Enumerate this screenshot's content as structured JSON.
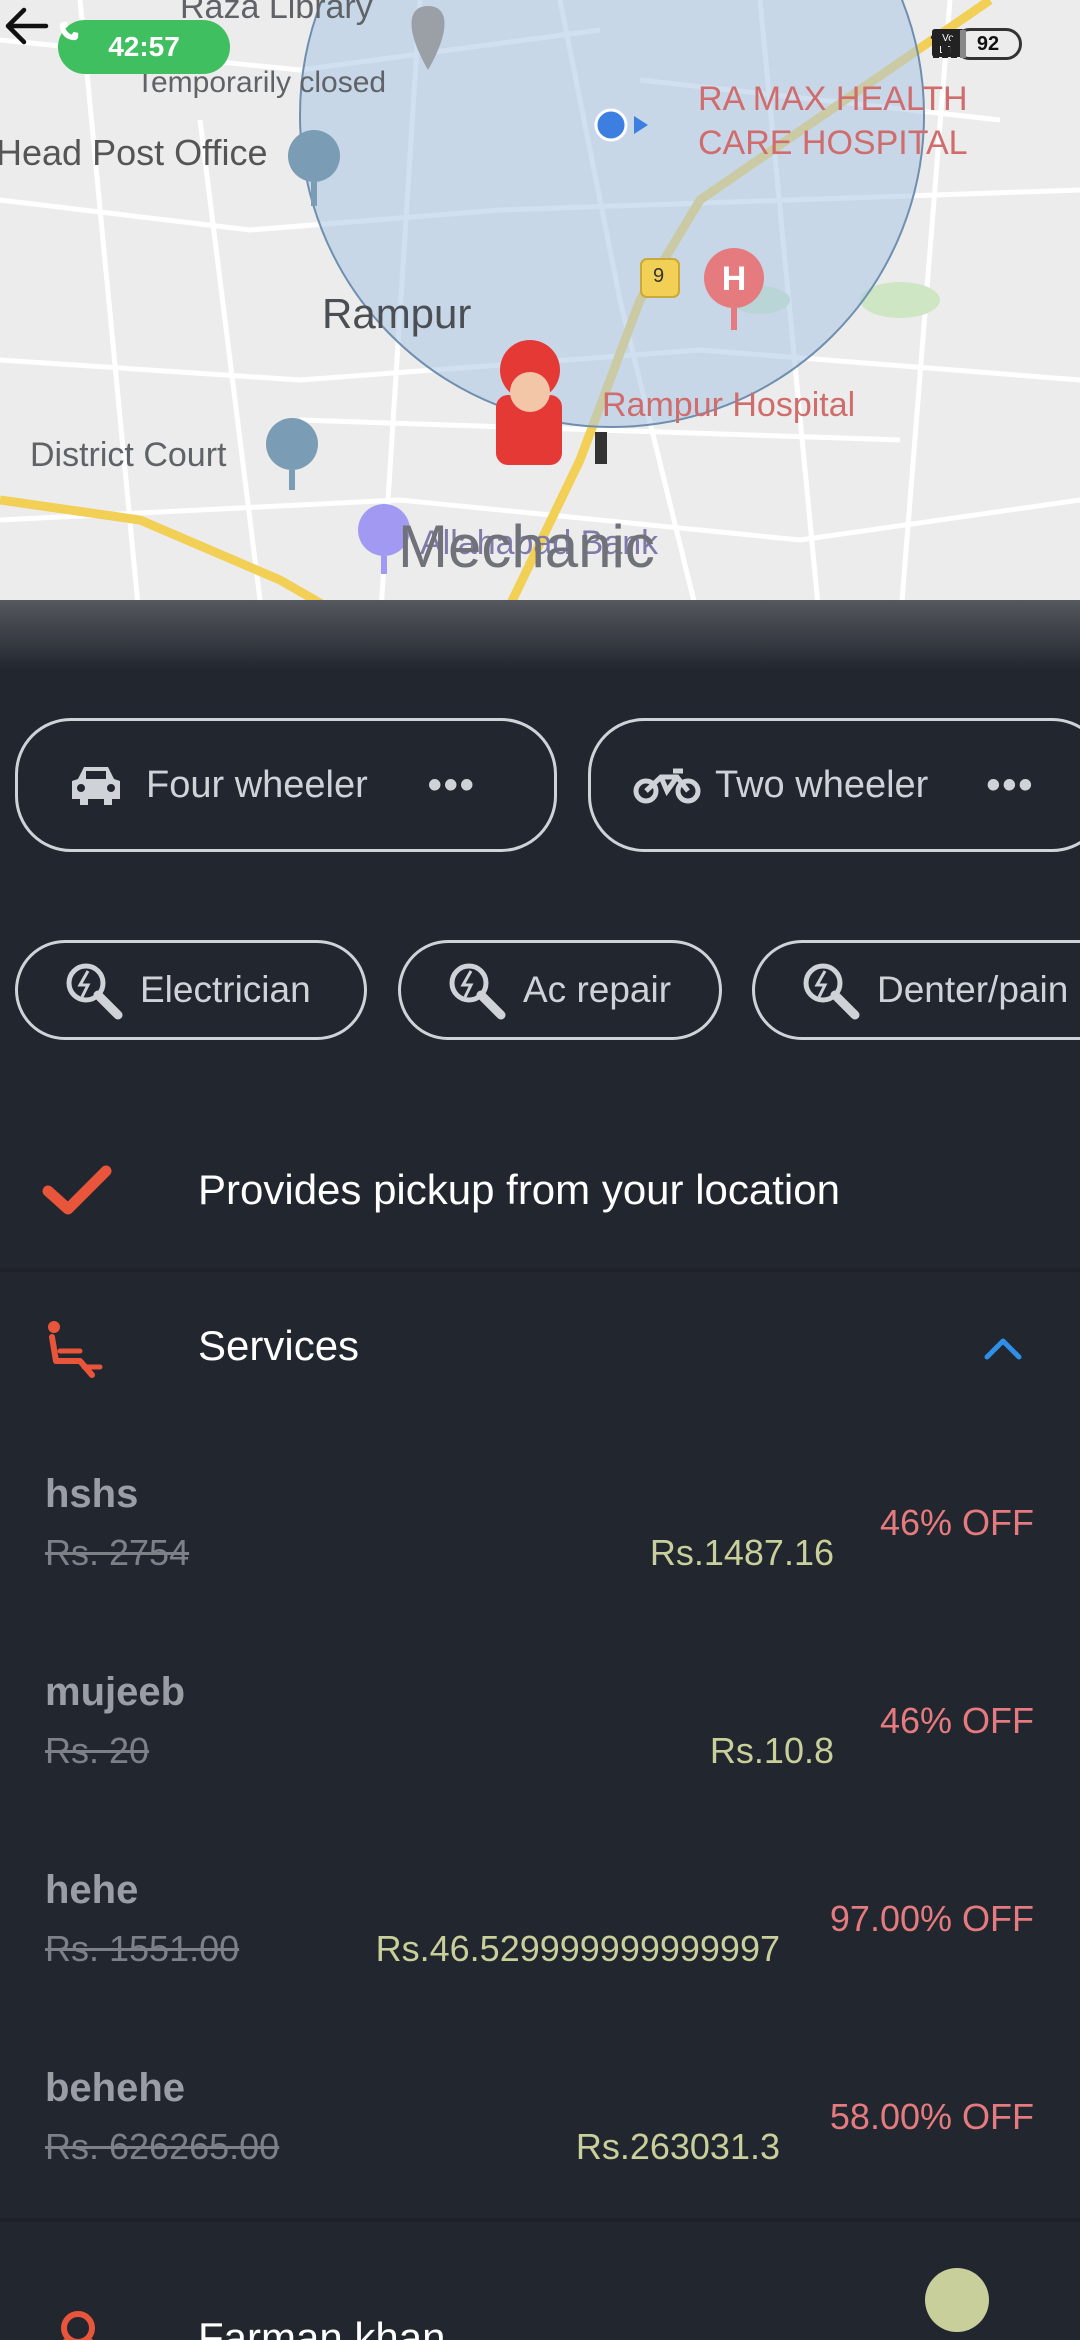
{
  "status_bar": {
    "call_time": "42:57",
    "network_1": "4G",
    "battery": "92"
  },
  "map": {
    "labels": {
      "raza_library": "Raza Library",
      "temporarily_closed": "Temporarily closed",
      "head_post_office": "Head Post Office",
      "rampur": "Rampur",
      "ramax_line1": "RA MAX HEALTH",
      "ramax_line2": "CARE HOSPITAL",
      "district_court": "District Court",
      "rampur_hospital": "Rampur Hospital",
      "allahabad_bank": "Allahabad Bank",
      "road_number": "9",
      "overlay_title": "Mechanic"
    }
  },
  "vehicle_types": [
    {
      "label": "Four wheeler",
      "icon": "car-icon"
    },
    {
      "label": "Two wheeler",
      "icon": "motorcycle-icon"
    }
  ],
  "service_types": [
    {
      "label": "Electrician",
      "icon": "wrench-bolt-icon"
    },
    {
      "label": "Ac repair",
      "icon": "wrench-bolt-icon"
    },
    {
      "label": "Denter/pain",
      "icon": "wrench-bolt-icon"
    }
  ],
  "pickup": {
    "label": "Provides pickup from your location",
    "icon": "checkmark-icon"
  },
  "services_section": {
    "title": "Services",
    "icon": "seat-icon",
    "toggle_icon": "chevron-up-icon",
    "items": [
      {
        "name": "hshs",
        "original_price": "Rs. 2754",
        "price": "Rs.1487.16",
        "discount": "46% OFF"
      },
      {
        "name": "mujeeb",
        "original_price": "Rs. 20",
        "price": "Rs.10.8",
        "discount": "46% OFF"
      },
      {
        "name": "hehe",
        "original_price": "Rs. 1551.00",
        "price": "Rs.46.529999999999997",
        "discount": "97.00% OFF"
      },
      {
        "name": "behehe",
        "original_price": "Rs. 626265.00",
        "price": "Rs.263031.3",
        "discount": "58.00% OFF"
      }
    ]
  },
  "owner": {
    "name": "Farman khan",
    "icon": "location-pin-icon"
  },
  "colors": {
    "background": "#22262e",
    "accent_orange": "#e8553a",
    "accent_blue": "#2f8fe6",
    "price_green": "#c8cf9a",
    "discount_red": "#e57b7e"
  }
}
